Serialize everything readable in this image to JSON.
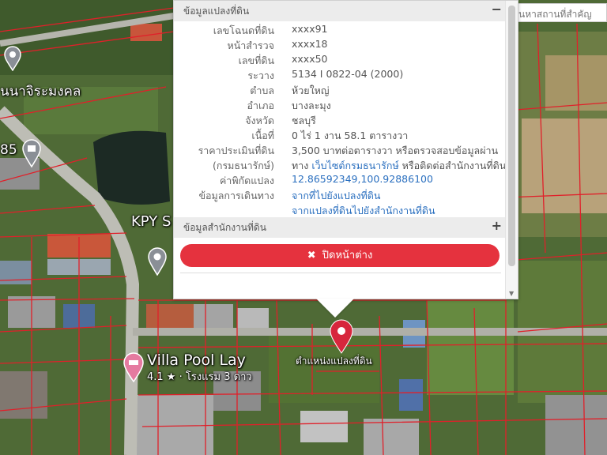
{
  "map": {
    "labels": {
      "road": "นนาจิระมงคล",
      "num185": "85",
      "kpy": "KPY S",
      "villa_name": "Villa Pool Lay",
      "villa_sub": "4.1 ★ · โรงแรม 3 ดาว",
      "target": "ตำแหน่งแปลงที่ดิน"
    },
    "colors": {
      "parcel_line": "#e0202a",
      "pin": "#d7263d"
    }
  },
  "search": {
    "placeholder": "ค้นหาสถานที่สำคัญ"
  },
  "popup": {
    "section1_title": "ข้อมูลแปลงที่ดิน",
    "section1_toggle": "−",
    "fields": [
      {
        "label": "เลขโฉนดที่ดิน",
        "value": "xxxx91"
      },
      {
        "label": "หน้าสำรวจ",
        "value": "xxxx18"
      },
      {
        "label": "เลขที่ดิน",
        "value": "xxxx50"
      },
      {
        "label": "ระวาง",
        "value": "5134 I 0822-04 (2000)"
      },
      {
        "label": "ตำบล",
        "value": "ห้วยใหญ่"
      },
      {
        "label": "อำเภอ",
        "value": "บางละมุง"
      },
      {
        "label": "จังหวัด",
        "value": "ชลบุรี"
      },
      {
        "label": "เนื้อที่",
        "value": "0 ไร่ 1 งาน 58.1 ตารางวา"
      }
    ],
    "price_label_1": "ราคาประเมินที่ดิน",
    "price_label_2": "(กรมธนารักษ์)",
    "price_value_1": "3,500 บาทต่อตารางวา หรือตรวจสอบข้อมูลผ่าน",
    "price_value_2_pre": "ทาง ",
    "price_value_2_link": "เว็บไซต์กรมธนารักษ์",
    "price_value_2_post": " หรือติดต่อสำนักงานที่ดิน",
    "coord_label": "ค่าพิกัดแปลง",
    "coord_value": "12.86592349,100.92886100",
    "travel_label": "ข้อมูลการเดินทาง",
    "travel_link_1": "จากที่ไปยังแปลงที่ดิน",
    "travel_link_2": "จากแปลงที่ดินไปยังสำนักงานที่ดิน",
    "section2_title": "ข้อมูลสำนักงานที่ดิน",
    "section2_toggle": "+",
    "close_icon": "✖",
    "close_label": "ปิดหน้าต่าง"
  }
}
